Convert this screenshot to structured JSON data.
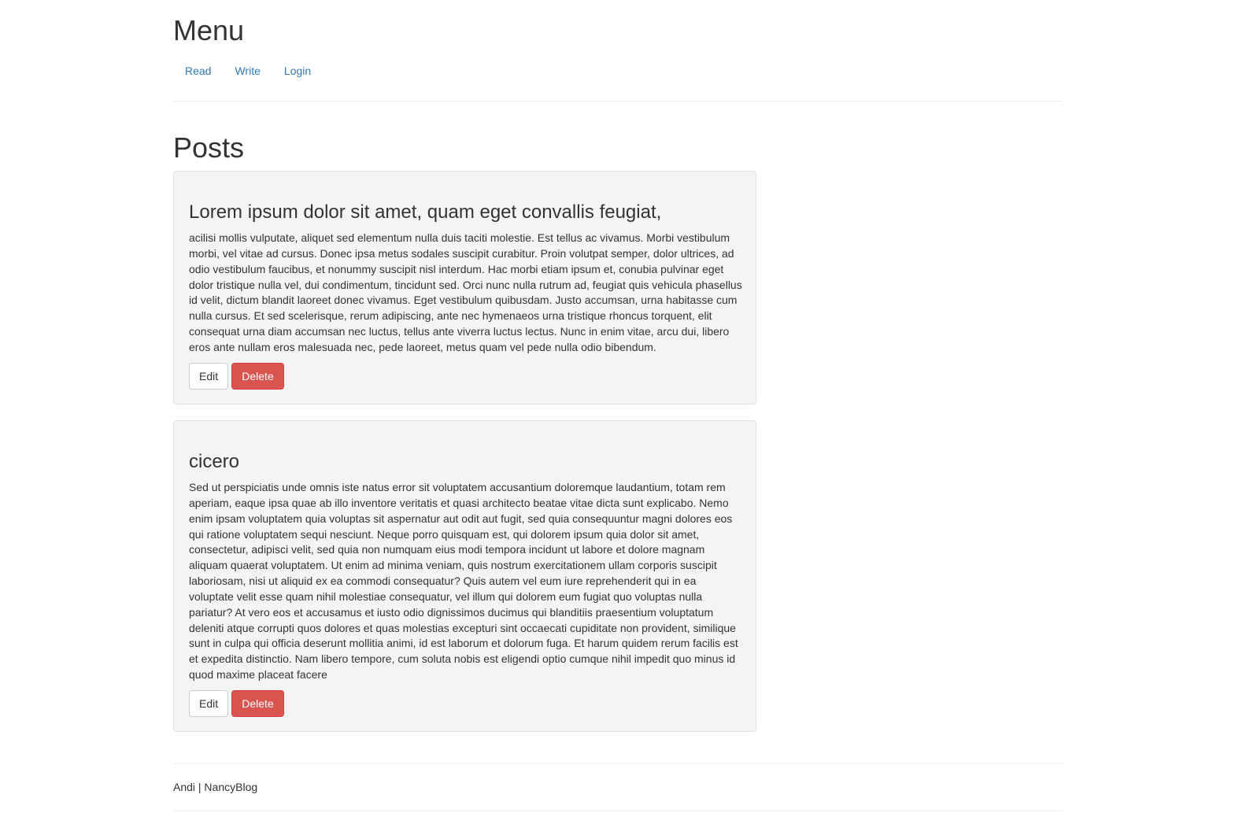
{
  "header": {
    "title": "Menu",
    "nav": [
      {
        "label": "Read"
      },
      {
        "label": "Write"
      },
      {
        "label": "Login"
      }
    ]
  },
  "main": {
    "title": "Posts",
    "posts": [
      {
        "title": "Lorem ipsum dolor sit amet, quam eget convallis feugiat,",
        "body": "acilisi mollis vulputate, aliquet sed elementum nulla duis taciti molestie. Est tellus ac vivamus. Morbi vestibulum morbi, vel vitae ad cursus. Donec ipsa metus sodales suscipit curabitur. Proin volutpat semper, dolor ultrices, ad odio vestibulum faucibus, et nonummy suscipit nisl interdum. Hac morbi etiam ipsum et, conubia pulvinar eget dolor tristique nulla vel, dui condimentum, tincidunt sed. Orci nunc nulla rutrum ad, feugiat quis vehicula phasellus id velit, dictum blandit laoreet donec vivamus. Eget vestibulum quibusdam. Justo accumsan, urna habitasse cum nulla cursus. Et sed scelerisque, rerum adipiscing, ante nec hymenaeos urna tristique rhoncus torquent, elit consequat urna diam accumsan nec luctus, tellus ante viverra luctus lectus. Nunc in enim vitae, arcu dui, libero eros ante nullam eros malesuada nec, pede laoreet, metus quam vel pede nulla odio bibendum.",
        "edit_label": "Edit",
        "delete_label": "Delete"
      },
      {
        "title": "cicero",
        "body": "Sed ut perspiciatis unde omnis iste natus error sit voluptatem accusantium doloremque laudantium, totam rem aperiam, eaque ipsa quae ab illo inventore veritatis et quasi architecto beatae vitae dicta sunt explicabo. Nemo enim ipsam voluptatem quia voluptas sit aspernatur aut odit aut fugit, sed quia consequuntur magni dolores eos qui ratione voluptatem sequi nesciunt. Neque porro quisquam est, qui dolorem ipsum quia dolor sit amet, consectetur, adipisci velit, sed quia non numquam eius modi tempora incidunt ut labore et dolore magnam aliquam quaerat voluptatem. Ut enim ad minima veniam, quis nostrum exercitationem ullam corporis suscipit laboriosam, nisi ut aliquid ex ea commodi consequatur? Quis autem vel eum iure reprehenderit qui in ea voluptate velit esse quam nihil molestiae consequatur, vel illum qui dolorem eum fugiat quo voluptas nulla pariatur? At vero eos et accusamus et iusto odio dignissimos ducimus qui blanditiis praesentium voluptatum deleniti atque corrupti quos dolores et quas molestias excepturi sint occaecati cupiditate non provident, similique sunt in culpa qui officia deserunt mollitia animi, id est laborum et dolorum fuga. Et harum quidem rerum facilis est et expedita distinctio. Nam libero tempore, cum soluta nobis est eligendi optio cumque nihil impedit quo minus id quod maxime placeat facere",
        "edit_label": "Edit",
        "delete_label": "Delete"
      }
    ]
  },
  "footer": {
    "text": "Andi | NancyBlog"
  },
  "colors": {
    "link": "#337ab7",
    "danger": "#d9534f",
    "well_background": "#f4f4f4"
  }
}
